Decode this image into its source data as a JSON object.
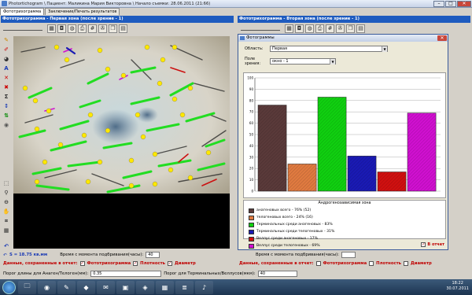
{
  "window": {
    "title": "Photortichogram \\ Пациент: Маликина Мария Викторовна \\ Начало съемки: 28.06.2011 (21:66)",
    "controls": [
      "–",
      "□",
      "✕"
    ]
  },
  "tabs": [
    {
      "label": "Фототрихограмма",
      "active": true
    },
    {
      "label": "Заключение/Печать результатов",
      "active": false
    }
  ],
  "left_panel": {
    "header": "Фототрихограмма - Первая зона (после зрение - 1)",
    "scale_label": "S = 18.75 кв.мм",
    "time_label": "Время с момента подбривания(часы):",
    "time_value": "40",
    "saved_label": "Данные, сохраненные в отчет:",
    "saved_items": [
      "Фототрихограмма",
      "Плотность",
      "Диаметр"
    ],
    "threshold_label": "Порог длины для Анаген/Телоген(мм):",
    "threshold_value": "0.35",
    "threshold2_label": "Порог для Терминальных/Веллусов(мкм):",
    "threshold2_value": "40"
  },
  "right_panel": {
    "header": "Фототрихограмма - Вторая зона (после зрение - 1)",
    "time_label": "Время с момента подбривания(часы):",
    "saved_label": "Данные, сохраненные в отчет:",
    "saved_items": [
      "Фототрихограмма",
      "Плотность",
      "Диаметр"
    ]
  },
  "dialog": {
    "title": "Фотограммы",
    "area_label": "Область:",
    "area_value": "Первая",
    "field_label": "Поле зрения:",
    "field_value": "окно - 1",
    "legend_title": "Андрогенозависимая зона",
    "report_label": "В отчет"
  },
  "chart_data": {
    "type": "bar",
    "ylim": [
      0,
      100
    ],
    "yticks": [
      "100",
      "90",
      "80",
      "70",
      "60",
      "50",
      "40",
      "30",
      "20",
      "10",
      "0"
    ],
    "categories": [
      "анагеновых всего - 76% (52)",
      "телогеновых всего - 24% (16)",
      "Терминальных среди анагеновых - 83%",
      "Терминальных среди телогеновых - 31%",
      "Веллус среди анагеновых - 17%",
      "Веллус среди телогеновых - 69%"
    ],
    "values": [
      76,
      24,
      83,
      31,
      17,
      69
    ],
    "colors": [
      "#5a3a3a",
      "#e07a40",
      "#10d010",
      "#1a1ab4",
      "#d01010",
      "#d010d0"
    ]
  },
  "taskbar": {
    "time": "18:22",
    "date": "30.07.2011",
    "apps": [
      "🗀",
      "◉",
      "✎",
      "◆",
      "✉",
      "▣",
      "◈",
      "▦",
      "≣",
      "♪"
    ]
  }
}
